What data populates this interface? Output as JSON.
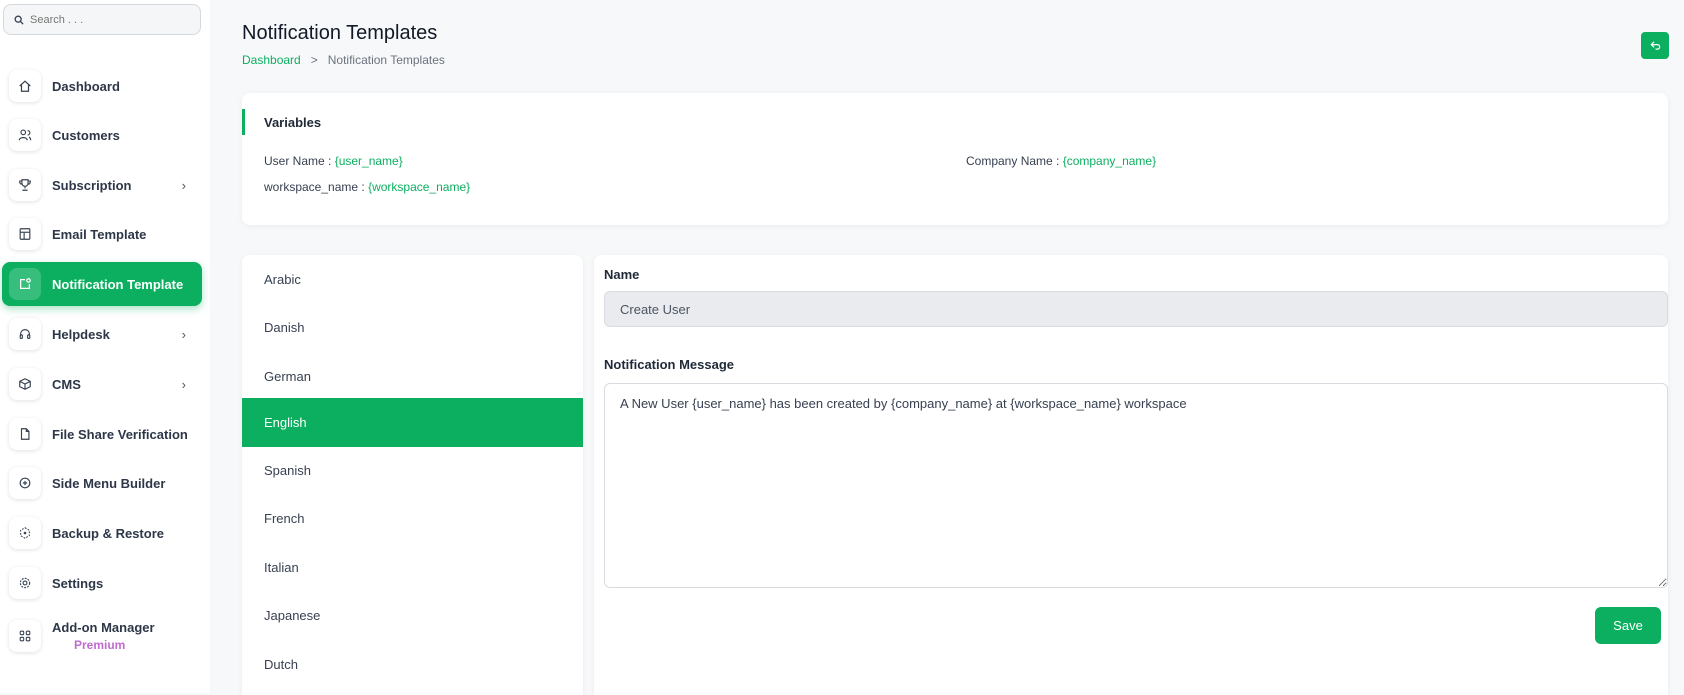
{
  "search": {
    "placeholder": "Search . . ."
  },
  "sidebar": {
    "items": [
      {
        "label": "Dashboard",
        "icon": "home-icon",
        "chevron": false
      },
      {
        "label": "Customers",
        "icon": "users-icon",
        "chevron": false
      },
      {
        "label": "Subscription",
        "icon": "trophy-icon",
        "chevron": true
      },
      {
        "label": "Email Template",
        "icon": "template-icon",
        "chevron": false
      },
      {
        "label": "Notification Template",
        "icon": "notification-icon",
        "chevron": false,
        "active": true
      },
      {
        "label": "Helpdesk",
        "icon": "headset-icon",
        "chevron": true
      },
      {
        "label": "CMS",
        "icon": "box-icon",
        "chevron": true
      },
      {
        "label": "File Share Verification",
        "icon": "file-icon",
        "chevron": false
      },
      {
        "label": "Side Menu Builder",
        "icon": "plus-circle-icon",
        "chevron": false
      },
      {
        "label": "Backup & Restore",
        "icon": "backup-icon",
        "chevron": false
      },
      {
        "label": "Settings",
        "icon": "gear-icon",
        "chevron": false
      },
      {
        "label": "Add-on Manager",
        "icon": "grid-icon",
        "chevron": false
      }
    ],
    "premium_label": "Premium"
  },
  "header": {
    "title": "Notification Templates",
    "breadcrumb": {
      "link": "Dashboard",
      "separator": ">",
      "current": "Notification Templates"
    }
  },
  "variables": {
    "title": "Variables",
    "items": [
      {
        "label": "User Name : ",
        "value": "{user_name}"
      },
      {
        "label": "Company Name : ",
        "value": "{company_name}"
      },
      {
        "label": "workspace_name : ",
        "value": "{workspace_name}"
      }
    ]
  },
  "languages": [
    "Arabic",
    "Danish",
    "German",
    "English",
    "Spanish",
    "French",
    "Italian",
    "Japanese",
    "Dutch"
  ],
  "selected_language": "English",
  "form": {
    "name_label": "Name",
    "name_value": "Create User",
    "message_label": "Notification Message",
    "message_value": "A New User {user_name} has been created by {company_name} at {workspace_name} workspace",
    "save_label": "Save"
  },
  "colors": {
    "accent": "#0caf60",
    "premium": "#c06bd0"
  }
}
